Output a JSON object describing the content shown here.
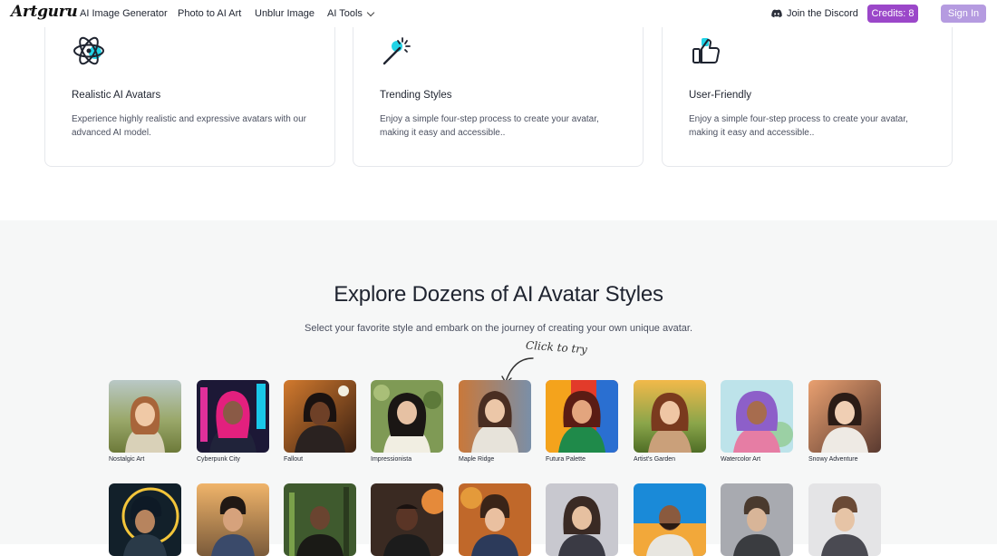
{
  "nav": {
    "logo": "Artguru",
    "links": [
      "AI Image Generator",
      "Photo to AI Art",
      "Unblur Image",
      "AI Tools"
    ],
    "discord": "Join the Discord",
    "credits": "Credits: 8",
    "signin": "Sign In"
  },
  "features": [
    {
      "title": "Realistic AI Avatars",
      "desc": "Experience highly realistic and expressive avatars with our advanced AI model.",
      "icon": "atom-icon"
    },
    {
      "title": "Trending Styles",
      "desc": "Enjoy a simple four-step process to create your avatar, making it easy and accessible..",
      "icon": "magic-wand-icon"
    },
    {
      "title": "User-Friendly",
      "desc": "Enjoy a simple four-step process to create your avatar, making it easy and accessible..",
      "icon": "thumbs-up-icon"
    }
  ],
  "explore": {
    "title": "Explore Dozens of AI Avatar Styles",
    "subtitle": "Select your favorite style and embark on the journey of creating your own unique avatar.",
    "hint": "Click to try"
  },
  "styles_row1": [
    "Nostalgic Art",
    "Cyberpunk City",
    "Fallout",
    "Impressionista",
    "Maple Ridge",
    "Futura Palette",
    "Artist's Garden",
    "Watercolor Art",
    "Snowy Adventure"
  ],
  "colors": {
    "credits": "#9b47c9",
    "signin": "#b59be0",
    "accent_cyan": "#22d3e6"
  }
}
